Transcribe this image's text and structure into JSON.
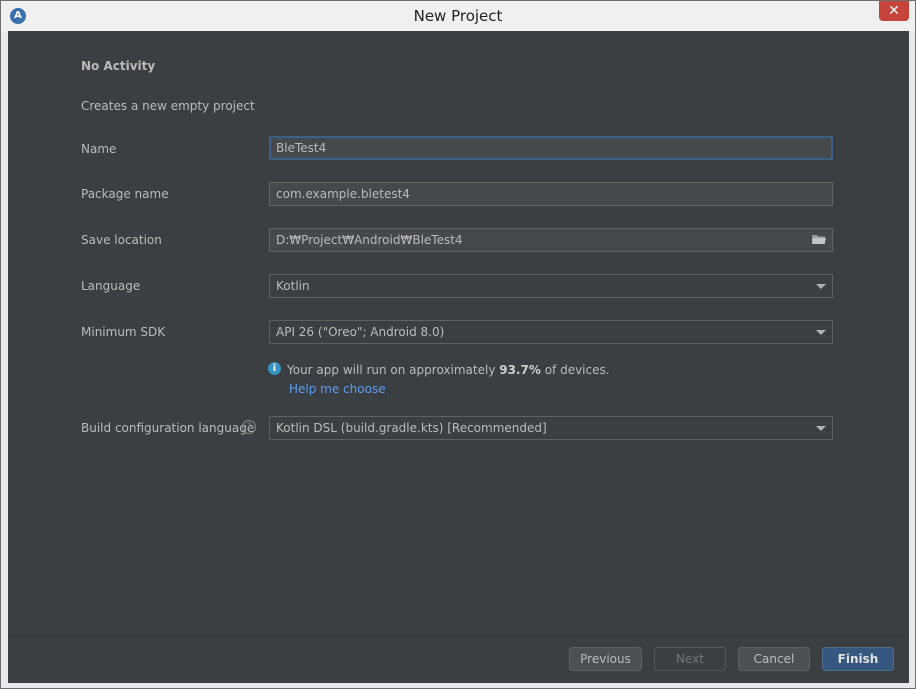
{
  "window": {
    "title": "New Project",
    "close_glyph": "✕"
  },
  "template": {
    "heading": "No Activity",
    "description": "Creates a new empty project"
  },
  "form": {
    "name": {
      "label": "Name",
      "value": "BleTest4"
    },
    "package_name": {
      "label": "Package name",
      "value": "com.example.bletest4"
    },
    "save_location": {
      "label": "Save location",
      "value": "D:₩Project₩Android₩BleTest4"
    },
    "language": {
      "label": "Language",
      "value": "Kotlin"
    },
    "minimum_sdk": {
      "label": "Minimum SDK",
      "value": "API 26 (\"Oreo\"; Android 8.0)"
    },
    "build_config": {
      "label": "Build configuration language",
      "value": "Kotlin DSL (build.gradle.kts) [Recommended]"
    }
  },
  "info": {
    "prefix": "Your app will run on approximately ",
    "percent": "93.7%",
    "suffix": " of devices.",
    "help_link": "Help me choose"
  },
  "buttons": {
    "previous": "Previous",
    "next": "Next",
    "cancel": "Cancel",
    "finish": "Finish"
  },
  "colors": {
    "background": "#3c3f41",
    "accent": "#365880",
    "link": "#589df6",
    "close": "#c7443a"
  }
}
